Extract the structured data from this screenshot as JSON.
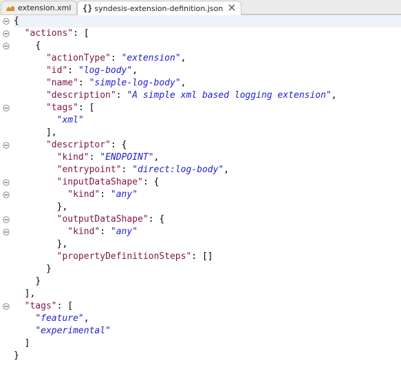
{
  "tabs": [
    {
      "label": "extension.xml",
      "icon": "camel"
    },
    {
      "label": "syndesis-extension-definition.json",
      "icon": "braces",
      "active": true,
      "closable": true
    }
  ],
  "json_text": "{\n  \"actions\": [\n    {\n      \"actionType\": \"extension\",\n      \"id\": \"log-body\",\n      \"name\": \"simple-log-body\",\n      \"description\": \"A simple xml based logging extension\",\n      \"tags\": [\n        \"xml\"\n      ],\n      \"descriptor\": {\n        \"kind\": \"ENDPOINT\",\n        \"entrypoint\": \"direct:log-body\",\n        \"inputDataShape\": {\n          \"kind\": \"any\"\n        },\n        \"outputDataShape\": {\n          \"kind\": \"any\"\n        },\n        \"propertyDefinitionSteps\": []\n      }\n    }\n  ],\n  \"tags\": [\n    \"feature\",\n    \"experimental\"\n  ]\n}",
  "fold_marks": [
    0,
    1,
    2,
    7,
    10,
    13,
    14,
    16,
    17,
    23
  ],
  "highlight_line": 0,
  "colors": {
    "key": "#7b1546",
    "string": "#2020d0"
  }
}
